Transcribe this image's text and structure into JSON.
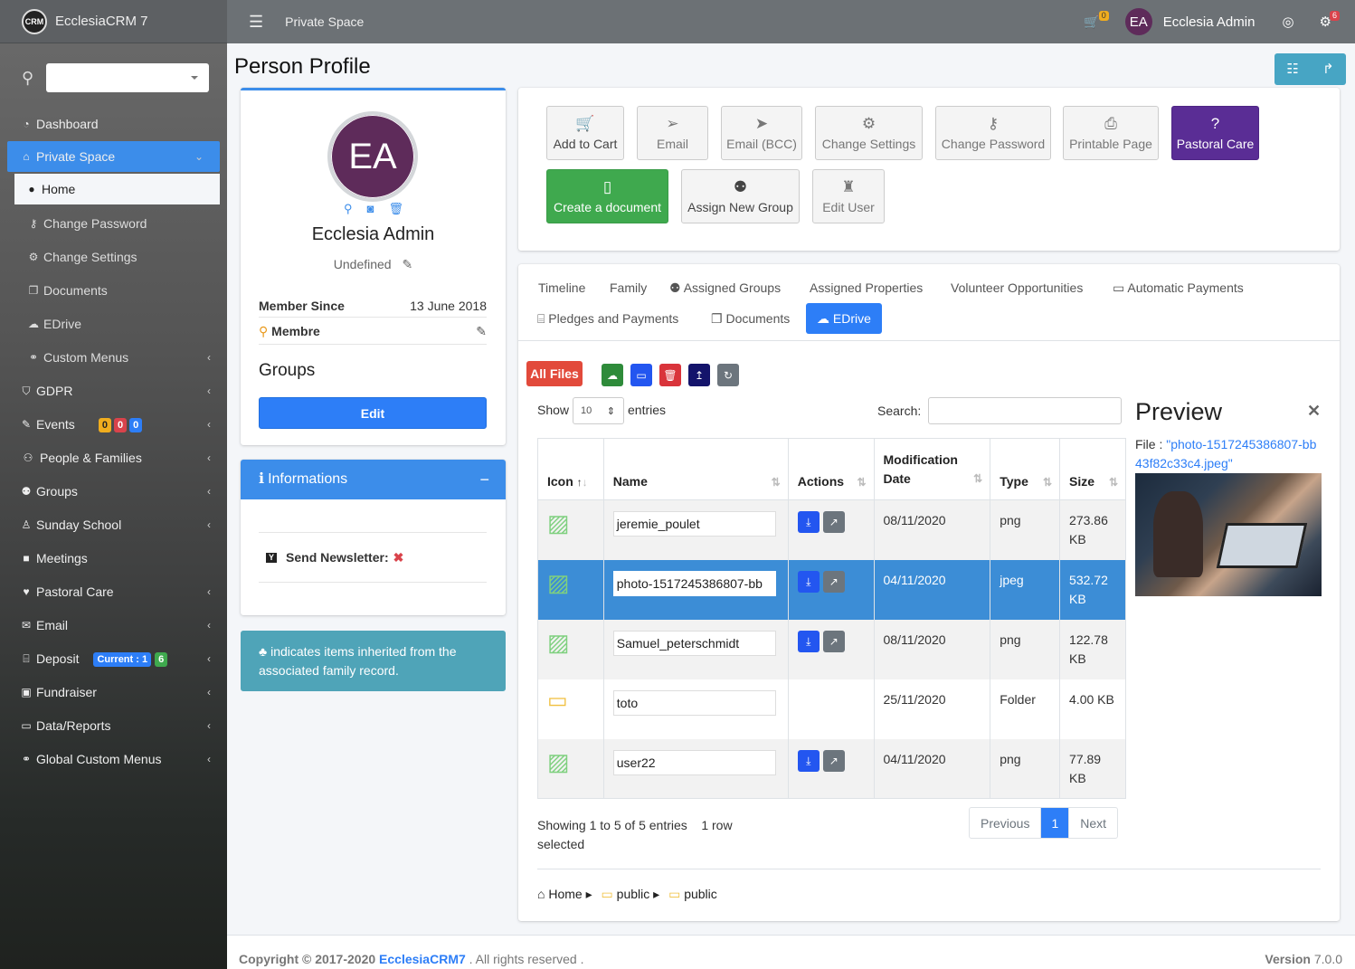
{
  "app": {
    "title": "EcclesiaCRM 7",
    "logo_text": "CRM"
  },
  "sidebar": {
    "items": [
      {
        "label": "Dashboard",
        "icon": "dashboard-icon"
      },
      {
        "label": "Private Space",
        "icon": "home-icon"
      },
      {
        "label": "Home",
        "icon": "user-icon"
      },
      {
        "label": "Change Password",
        "icon": "key-icon"
      },
      {
        "label": "Change Settings",
        "icon": "gear-icon"
      },
      {
        "label": "Documents",
        "icon": "copy-icon"
      },
      {
        "label": "EDrive",
        "icon": "cloud-icon"
      },
      {
        "label": "Custom Menus",
        "icon": "link-icon"
      },
      {
        "label": "GDPR",
        "icon": "shield-icon"
      },
      {
        "label": "Events",
        "icon": "ticket-icon"
      },
      {
        "label": "People & Families",
        "icon": "people-icon"
      },
      {
        "label": "Groups",
        "icon": "users-icon"
      },
      {
        "label": "Sunday School",
        "icon": "child-icon"
      },
      {
        "label": "Meetings",
        "icon": "video-icon"
      },
      {
        "label": "Pastoral Care",
        "icon": "heart-icon"
      },
      {
        "label": "Email",
        "icon": "envelope-icon"
      },
      {
        "label": "Deposit",
        "icon": "bank-icon"
      },
      {
        "label": "Fundraiser",
        "icon": "money-icon"
      },
      {
        "label": "Data/Reports",
        "icon": "file-icon"
      },
      {
        "label": "Global Custom Menus",
        "icon": "link-icon"
      }
    ],
    "events_badges": [
      "0",
      "0",
      "0"
    ],
    "deposit_badges": [
      "Current : 1",
      "6"
    ]
  },
  "topbar": {
    "breadcrumb": "Private Space",
    "cart_count": "0",
    "user_initials": "EA",
    "user_name": "Ecclesia Admin",
    "notif_count": "6"
  },
  "page": {
    "title": "Person Profile"
  },
  "profile": {
    "initials": "EA",
    "name": "Ecclesia Admin",
    "subtitle": "Undefined",
    "member_since_label": "Member Since",
    "member_since_value": "13 June 2018",
    "role": "Membre",
    "groups_title": "Groups",
    "edit_label": "Edit"
  },
  "informations": {
    "title": "Informations",
    "newsletter_label": "Send Newsletter:",
    "newsletter_value": "✖"
  },
  "note": {
    "text": "indicates items inherited from the associated family record."
  },
  "actions": [
    {
      "label": "Add to Cart",
      "icon": "cart-plus-icon"
    },
    {
      "label": "Email",
      "icon": "paper-plane-icon"
    },
    {
      "label": "Email (BCC)",
      "icon": "paper-plane-filled-icon"
    },
    {
      "label": "Change Settings",
      "icon": "gear-icon"
    },
    {
      "label": "Change Password",
      "icon": "key-icon"
    },
    {
      "label": "Printable Page",
      "icon": "print-icon"
    },
    {
      "label": "Pastoral Care",
      "icon": "question-icon"
    },
    {
      "label": "Create a document",
      "icon": "file-icon"
    },
    {
      "label": "Assign New Group",
      "icon": "users-icon"
    },
    {
      "label": "Edit User",
      "icon": "user-secret-icon"
    }
  ],
  "tabs": [
    "Timeline",
    "Family",
    "Assigned Groups",
    "Assigned Properties",
    "Volunteer Opportunities",
    "Automatic Payments",
    "Pledges and Payments",
    "Documents",
    "EDrive"
  ],
  "edrive": {
    "all_files_label": "All Files",
    "show_label": "Show",
    "show_value": "10",
    "entries_label": "entries",
    "search_label": "Search:",
    "columns": [
      "Icon",
      "Name",
      "Actions",
      "Modification Date",
      "Type",
      "Size"
    ],
    "rows": [
      {
        "name": "jeremie_poulet",
        "date": "08/11/2020",
        "type": "png",
        "size": "273.86 KB",
        "kind": "image"
      },
      {
        "name": "photo-1517245386807-bb",
        "date": "04/11/2020",
        "type": "jpeg",
        "size": "532.72 KB",
        "kind": "image"
      },
      {
        "name": "Samuel_peterschmidt",
        "date": "08/11/2020",
        "type": "png",
        "size": "122.78 KB",
        "kind": "image"
      },
      {
        "name": "toto",
        "date": "25/11/2020",
        "type": "Folder",
        "size": "4.00 KB",
        "kind": "folder"
      },
      {
        "name": "user22",
        "date": "04/11/2020",
        "type": "png",
        "size": "77.89 KB",
        "kind": "image"
      }
    ],
    "info": "Showing 1 to 5 of 5 entries",
    "selection": "1 row selected",
    "pager": {
      "prev": "Previous",
      "current": "1",
      "next": "Next"
    },
    "breadcrumb": [
      "Home",
      "public",
      "public"
    ],
    "preview_title": "Preview",
    "preview_file_label": "File :",
    "preview_file_name": "\"photo-1517245386807-bb43f82c33c4.jpeg\""
  },
  "footer": {
    "copyright": "Copyright © 2017-2020",
    "brand": "EcclesiaCRM7",
    "rights": ". All rights reserved .",
    "version_label": "Version",
    "version_value": "7.0.0"
  },
  "colors": {
    "primary": "#2d7ef7",
    "green": "#3fa94e",
    "purple": "#5a2d95",
    "danger": "#e24a3b",
    "info": "#4fa4b8"
  }
}
